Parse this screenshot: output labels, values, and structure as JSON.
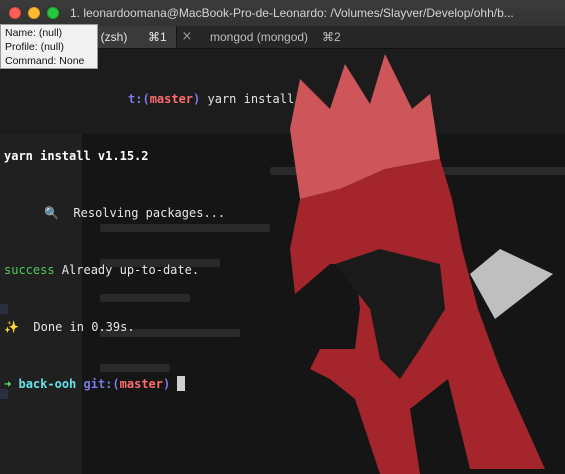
{
  "window": {
    "title": "1. leonardoomana@MacBook-Pro-de-Leonardo: /Volumes/Slayver/Develop/ohh/b...",
    "colors": {
      "close": "#ff5f57",
      "minimize": "#febc2e",
      "zoom": "#28c840"
    }
  },
  "tabs": [
    {
      "label": "oh (zsh)",
      "shortcut": "⌘1",
      "active": true
    },
    {
      "label": "mongod (mongod)",
      "shortcut": "⌘2",
      "active": false
    }
  ],
  "tab_close_icon": "×",
  "tooltip": {
    "name": "Name: (null)",
    "profile": "Profile: (null)",
    "command": "Command: None"
  },
  "terminal": {
    "line1": {
      "partial": "t",
      "git_open": ":(",
      "branch": "master",
      "git_close": ")",
      "command": " yarn install"
    },
    "line2": {
      "text": "yarn install v1.15.2"
    },
    "line3": {
      "icon": "🔍",
      "text": "  Resolving packages..."
    },
    "line4": {
      "status": "success",
      "text": " Already up-to-date."
    },
    "line5": {
      "icon": "✨",
      "text": "  Done in 0.39s."
    },
    "line6": {
      "arrow": "➜",
      "dir": "back-ooh",
      "git": "git",
      "git_open": ":(",
      "branch": "master",
      "git_close": ")"
    },
    "colors": {
      "prompt_arrow": "#5ff27a",
      "dir": "#64e3e8",
      "git": "#7a7ae8",
      "branch": "#ff6b6b",
      "success": "#4ec95a",
      "helmet": "#a4262c",
      "helmet_light": "#d85a5f"
    }
  }
}
